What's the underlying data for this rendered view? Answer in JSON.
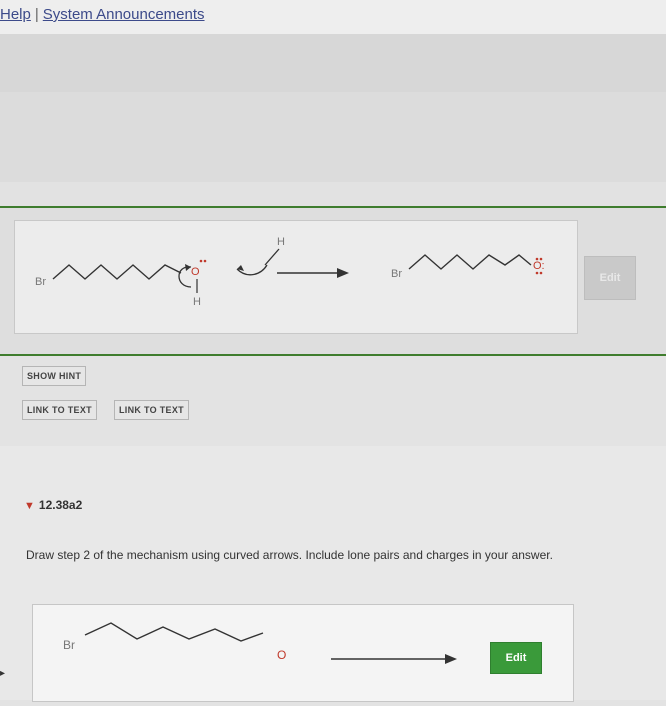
{
  "header": {
    "help_link": "Help",
    "separator": "|",
    "announcements_link": "System Announcements"
  },
  "step_panel": {
    "reactant": {
      "bromine_label": "Br",
      "oxygen_label": "O",
      "hydrogen_label": "H"
    },
    "reagent": {
      "hydrogen_label": "H"
    },
    "product": {
      "bromine_label": "Br",
      "oxygen_label": "O:"
    },
    "edit_button": "Edit"
  },
  "buttons": {
    "show_hint": "SHOW HINT",
    "link_to_text_1": "LINK TO TEXT",
    "link_to_text_2": "LINK TO TEXT"
  },
  "problem": {
    "id": "12.38a2",
    "instructions": "Draw step 2 of the mechanism using curved arrows. Include lone pairs and charges in your answer.",
    "answer": {
      "bromine_label": "Br",
      "oxygen_label": "O",
      "edit_button": "Edit"
    }
  },
  "colors": {
    "accent_green": "#3f7d2e",
    "edit_green": "#3a9a3a",
    "arrow_red": "#c0392b",
    "link_blue": "#3c4a8a"
  }
}
